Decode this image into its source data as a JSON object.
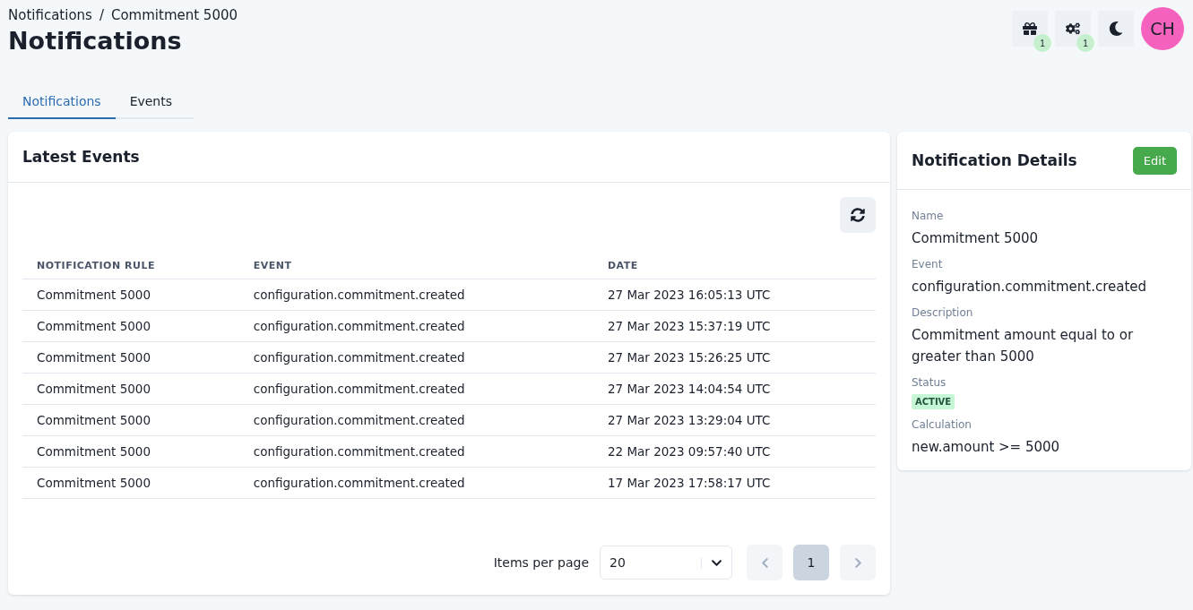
{
  "breadcrumb": [
    {
      "label": "Notifications"
    },
    {
      "label": "Commitment 5000"
    }
  ],
  "breadcrumb_separator": "/",
  "title": "Notifications",
  "header_actions": [
    {
      "kind": "gift",
      "badge": "1"
    },
    {
      "kind": "gears",
      "badge": "1"
    },
    {
      "kind": "moon"
    }
  ],
  "avatar": "CH",
  "tabs": [
    {
      "label": "Notifications",
      "selected": true
    },
    {
      "label": "Events",
      "selected": false
    }
  ],
  "events_card": {
    "title": "Latest Events",
    "columns": [
      "NOTIFICATION RULE",
      "EVENT",
      "DATE"
    ],
    "rows": [
      [
        "Commitment 5000",
        "configuration.commitment.created",
        "27 Mar 2023 16:05:13 UTC"
      ],
      [
        "Commitment 5000",
        "configuration.commitment.created",
        "27 Mar 2023 15:37:19 UTC"
      ],
      [
        "Commitment 5000",
        "configuration.commitment.created",
        "27 Mar 2023 15:26:25 UTC"
      ],
      [
        "Commitment 5000",
        "configuration.commitment.created",
        "27 Mar 2023 14:04:54 UTC"
      ],
      [
        "Commitment 5000",
        "configuration.commitment.created",
        "27 Mar 2023 13:29:04 UTC"
      ],
      [
        "Commitment 5000",
        "configuration.commitment.created",
        "22 Mar 2023 09:57:40 UTC"
      ],
      [
        "Commitment 5000",
        "configuration.commitment.created",
        "17 Mar 2023 17:58:17 UTC"
      ]
    ],
    "items_per_page_label": "Items per page",
    "items_per_page": "20",
    "pages": [
      {
        "label": "1",
        "selected": true
      }
    ]
  },
  "details_card": {
    "title": "Notification Details",
    "edit_button": "Edit",
    "fields": [
      {
        "kind": "text",
        "label": "Name",
        "value": "Commitment 5000"
      },
      {
        "kind": "text",
        "label": "Event",
        "value": "configuration.commitment.created"
      },
      {
        "kind": "text",
        "label": "Description",
        "value": "Commitment amount equal to or greater than 5000"
      },
      {
        "kind": "badge",
        "label": "Status",
        "value": "ACTIVE"
      },
      {
        "kind": "text",
        "label": "Calculation",
        "value": "new.amount >= 5000"
      }
    ]
  }
}
